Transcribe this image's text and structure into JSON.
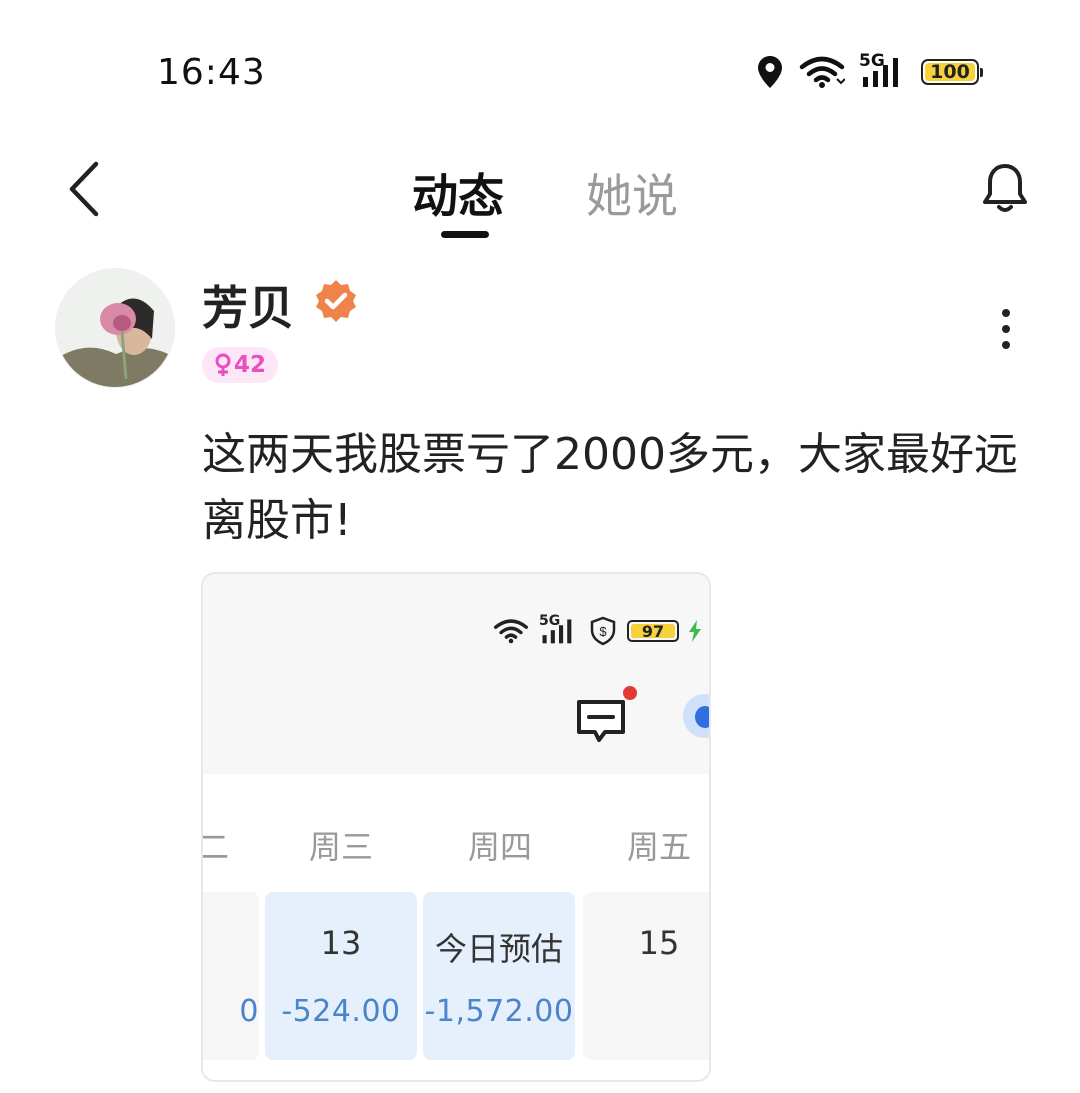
{
  "status_bar": {
    "time": "16:43",
    "network": "5G",
    "battery": "100"
  },
  "header": {
    "tabs": [
      {
        "label": "动态",
        "active": true
      },
      {
        "label": "她说",
        "active": false
      }
    ],
    "icons": [
      "back-arrow-icon",
      "bell-icon"
    ]
  },
  "post": {
    "author": "芳贝",
    "verified": true,
    "gender_age_badge": "42",
    "text": "这两天我股票亏了2000多元，大家最好远离股市!",
    "image": {
      "status_bar": {
        "network": "5G",
        "battery": "97"
      },
      "days": [
        "二",
        "周三",
        "周四",
        "周五"
      ],
      "cells": [
        {
          "label": "",
          "value": "0"
        },
        {
          "label": "13",
          "value": "-524.00"
        },
        {
          "label": "今日预估",
          "value": "-1,572.00"
        },
        {
          "label": "15",
          "value": ""
        }
      ]
    }
  },
  "colors": {
    "verified_badge": "#f0834a",
    "badge_pink": "#e84fc1",
    "loss_value": "#4a84c9",
    "cell_highlight": "#e6f0fc"
  }
}
